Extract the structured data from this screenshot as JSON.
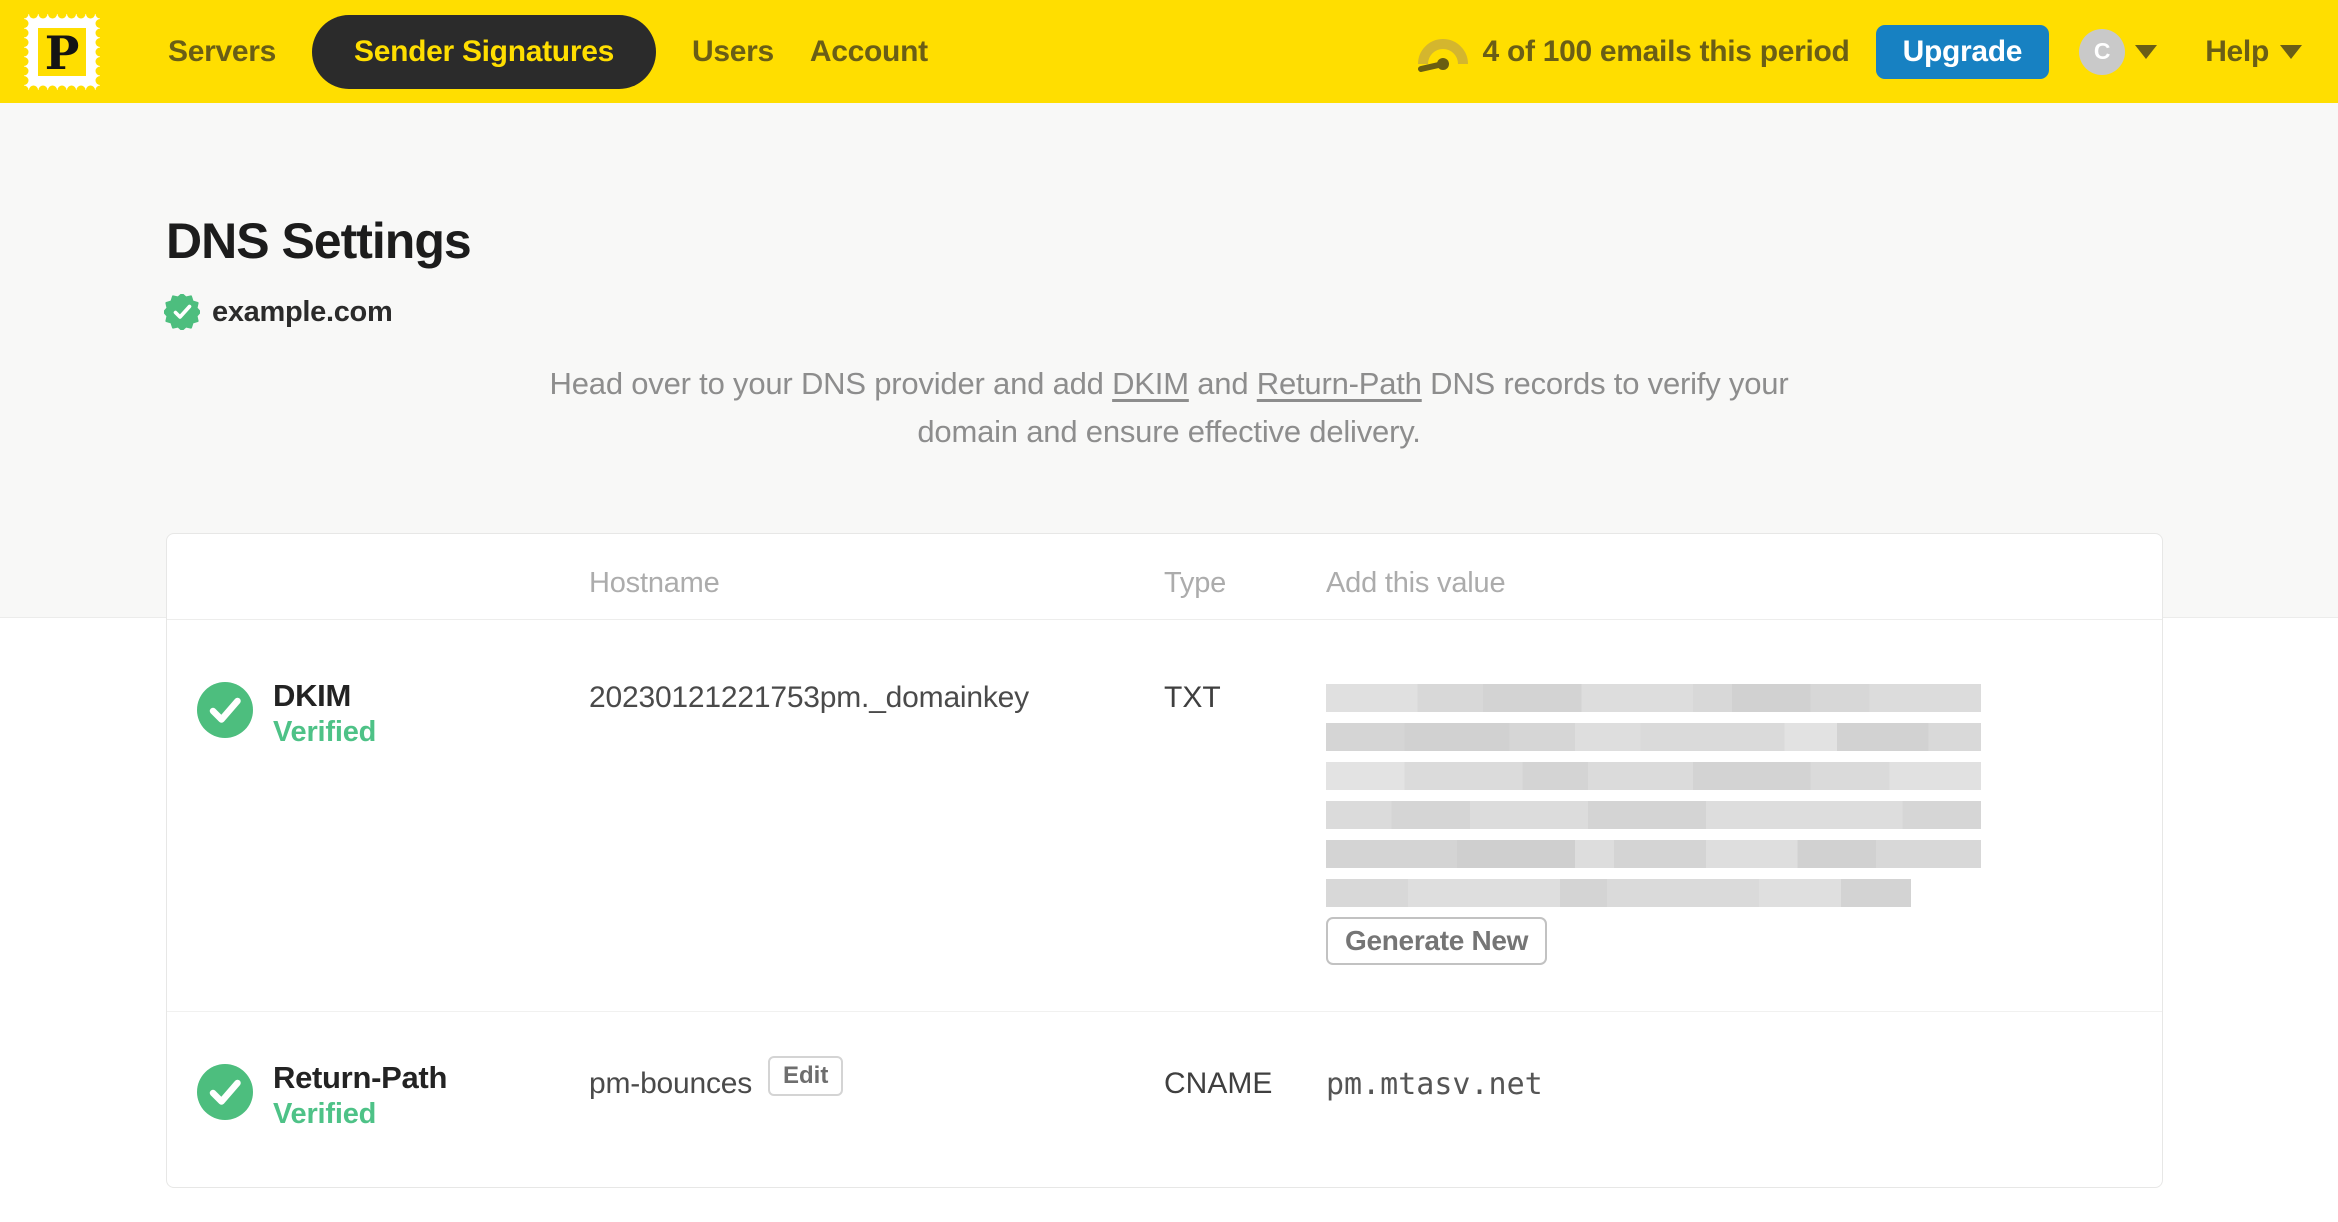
{
  "navbar": {
    "logo_letter": "P",
    "items": [
      {
        "label": "Servers",
        "active": false
      },
      {
        "label": "Sender Signatures",
        "active": true
      },
      {
        "label": "Users",
        "active": false
      },
      {
        "label": "Account",
        "active": false
      }
    ],
    "usage_text": "4 of 100 emails this period",
    "upgrade_label": "Upgrade",
    "avatar_initial": "C",
    "help_label": "Help"
  },
  "page": {
    "title": "DNS Settings",
    "domain": "example.com",
    "domain_verified": true,
    "description": {
      "part1": "Head over to your DNS provider and add ",
      "link_dkim": "DKIM",
      "part2": " and ",
      "link_return_path": "Return-Path",
      "part3": " DNS records to verify your domain and ensure effective delivery."
    }
  },
  "table": {
    "columns": {
      "hostname": "Hostname",
      "type": "Type",
      "value": "Add this value"
    },
    "rows": [
      {
        "name": "DKIM",
        "status": "Verified",
        "hostname": "20230121221753pm._domainkey",
        "type": "TXT",
        "value_redacted": true,
        "action_label": "Generate New"
      },
      {
        "name": "Return-Path",
        "status": "Verified",
        "hostname": "pm-bounces",
        "edit_label": "Edit",
        "type": "CNAME",
        "value": "pm.mtasv.net"
      }
    ]
  },
  "colors": {
    "brand_yellow": "#FFDE00",
    "nav_text_olive": "#6A5E16",
    "active_pill_bg": "#2B2B2B",
    "upgrade_blue": "#1781C2",
    "verified_green": "#4DBE7E",
    "page_bg_top": "#F8F8F7"
  }
}
